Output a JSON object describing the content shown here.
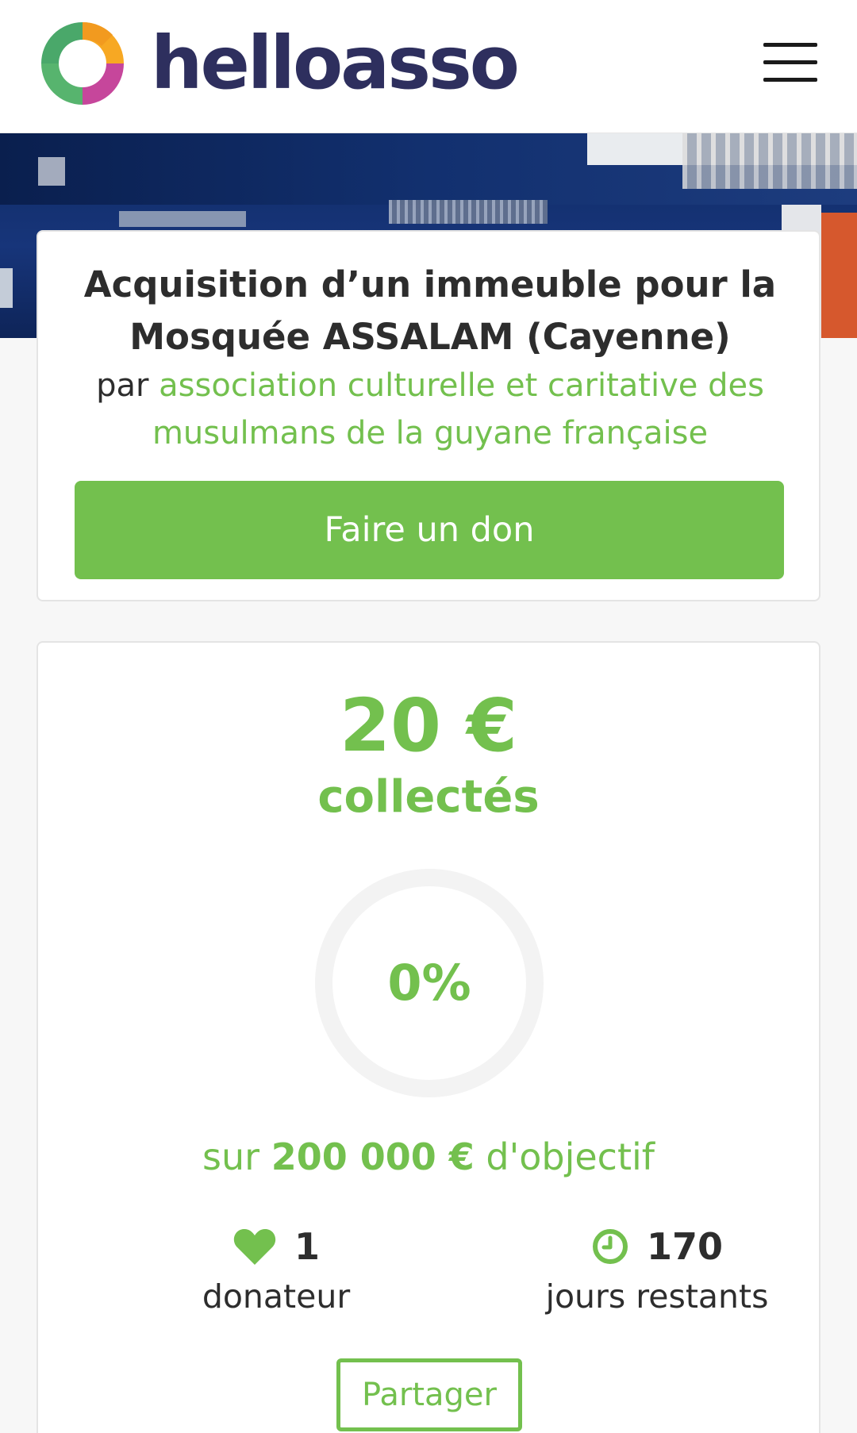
{
  "header": {
    "brand": "helloasso",
    "menu_icon": "hamburger-menu-icon",
    "logo_colors": [
      "#f7a823",
      "#c6469b",
      "#57b46e"
    ]
  },
  "campaign": {
    "title": "Acquisition d’un immeuble pour la Mosquée ASSALAM (Cayenne)",
    "by_prefix": "par",
    "organization": "association culturelle et caritative des musulmans de la guyane française",
    "donate_label": "Faire un don"
  },
  "stats": {
    "amount": "20 €",
    "amount_label": "collectés",
    "progress_percent_label": "0%",
    "progress_value": 0,
    "goal_prefix": "sur",
    "goal_amount": "200 000 €",
    "goal_suffix": "d'objectif",
    "donors_count": "1",
    "donors_label": "donateur",
    "days_count": "170",
    "days_label": "jours restants",
    "share_label": "Partager"
  },
  "colors": {
    "accent": "#73c04e",
    "brand_text": "#2e2f5e",
    "text": "#2d2d2d",
    "background": "#f7f7f7"
  }
}
